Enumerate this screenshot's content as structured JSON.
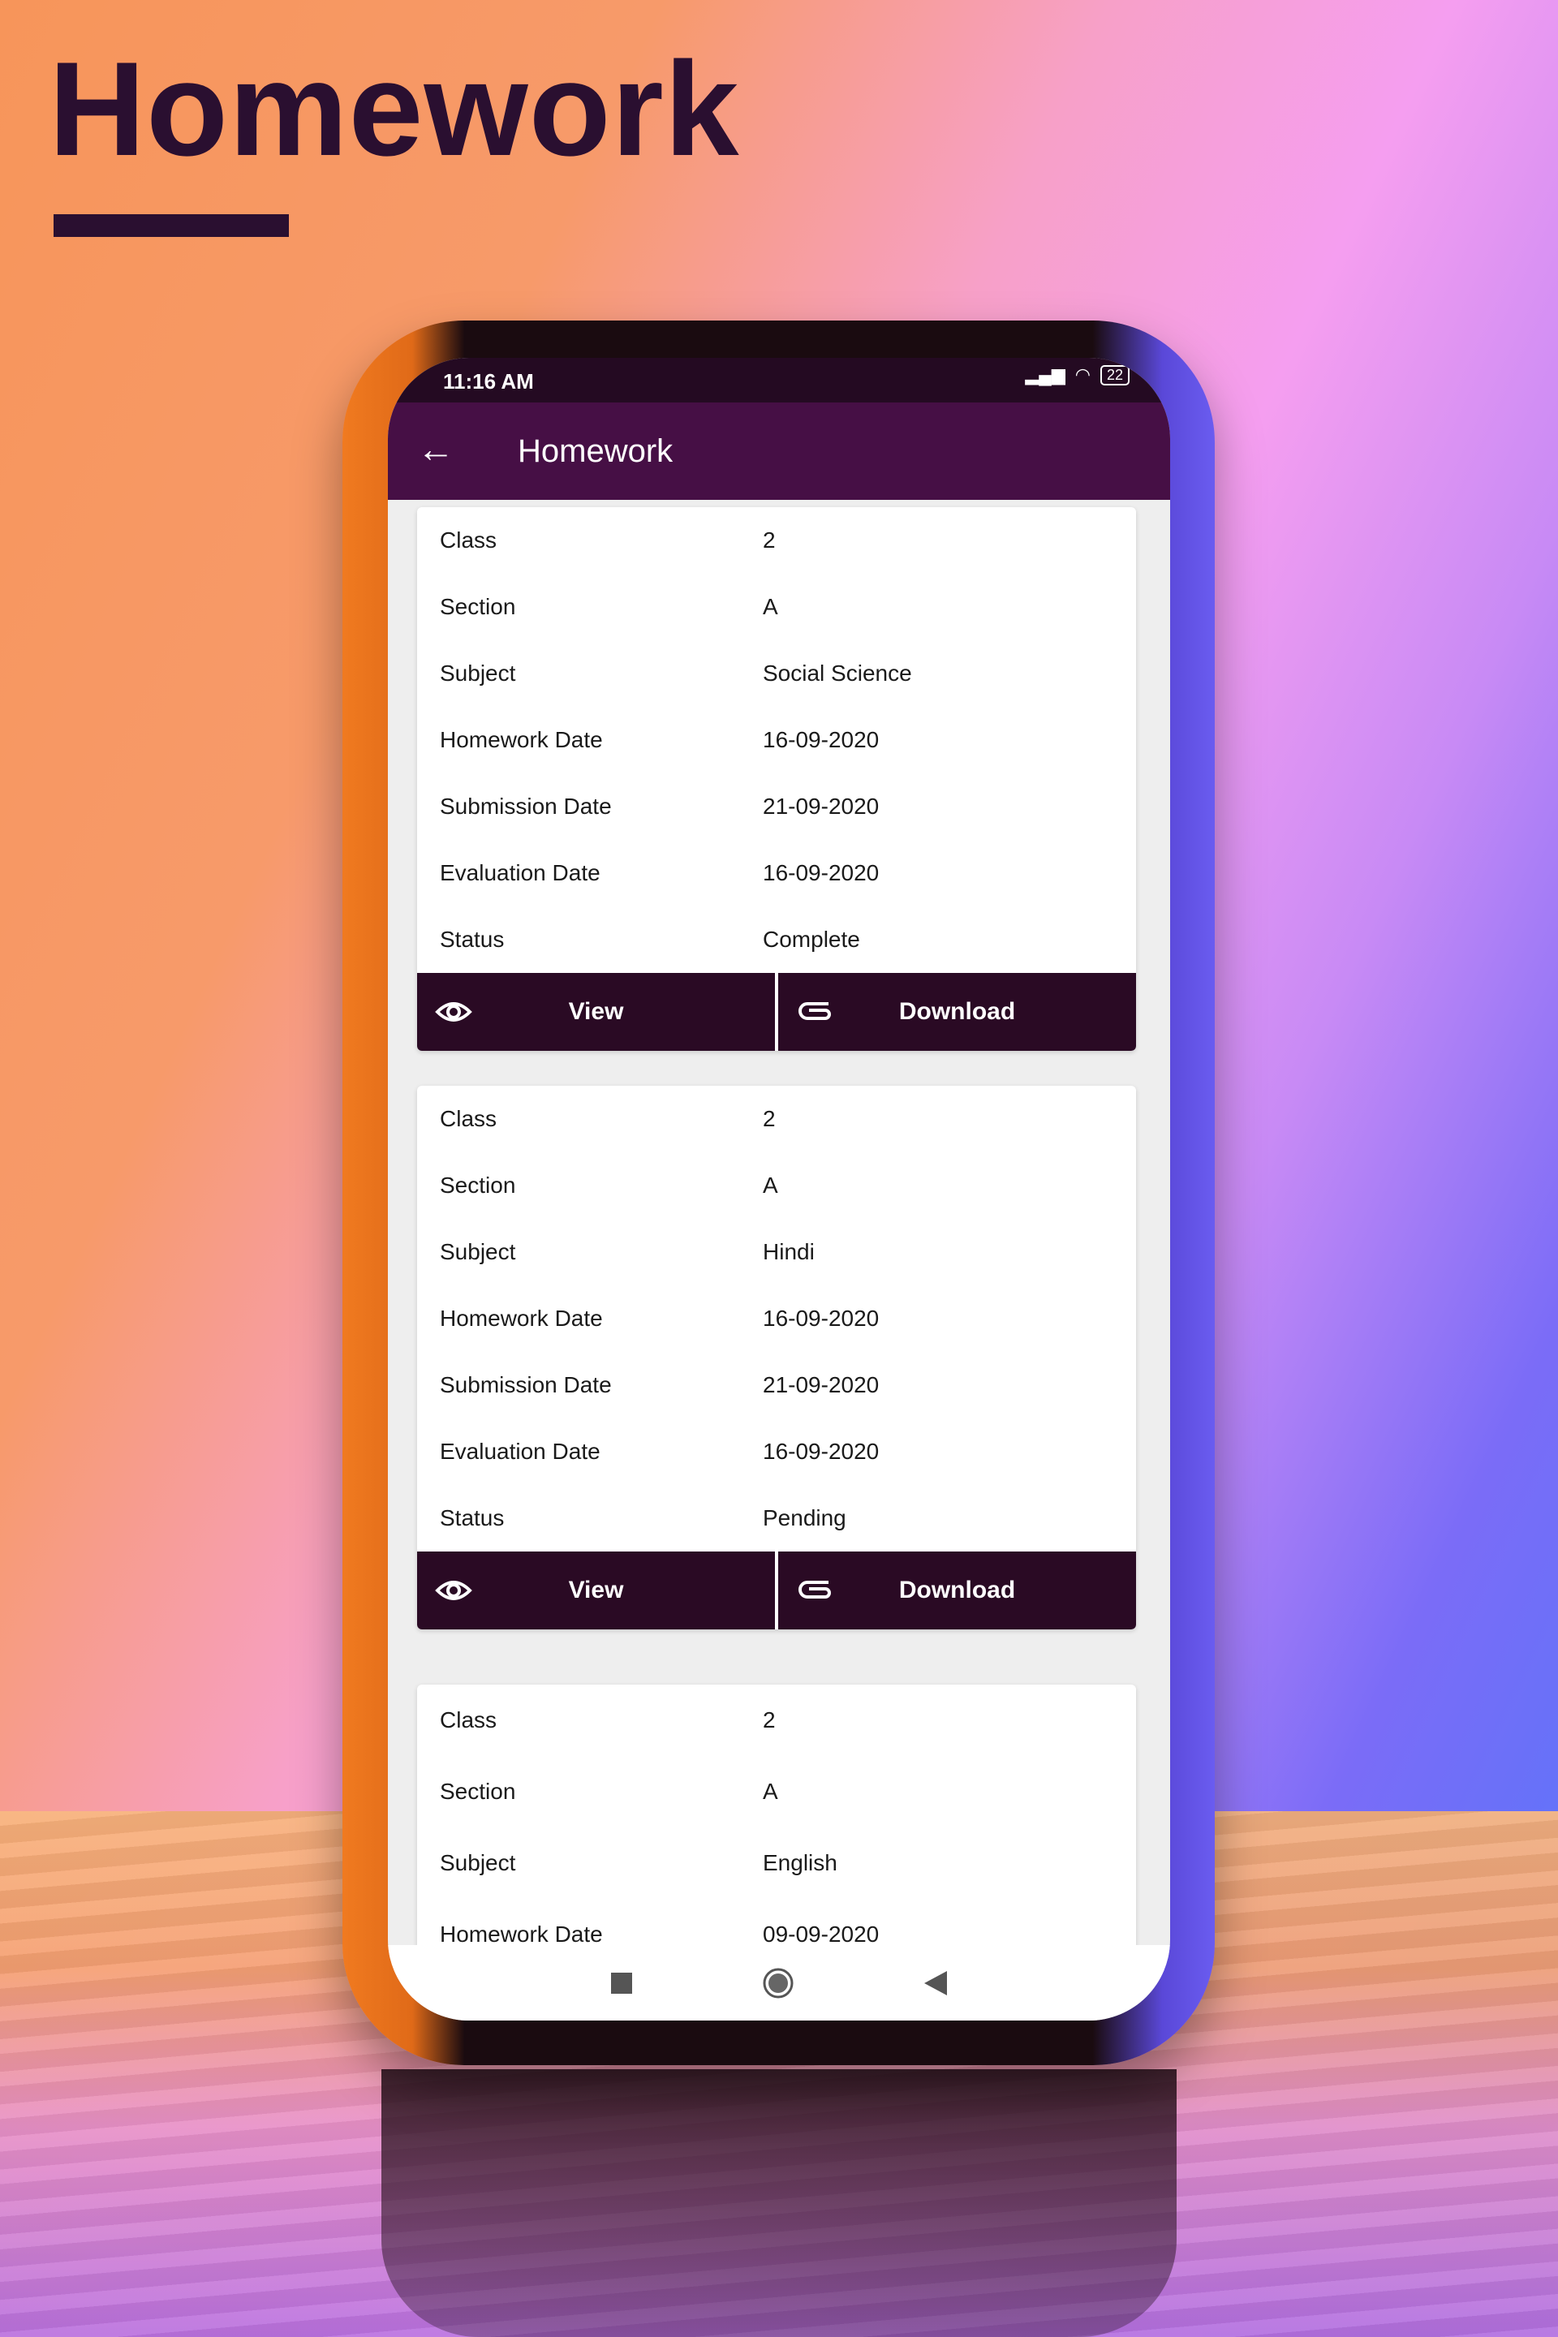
{
  "promo": {
    "title": "Homework"
  },
  "status_bar": {
    "time": "11:16 AM",
    "battery": "22"
  },
  "app_bar": {
    "title": "Homework"
  },
  "labels": {
    "class": "Class",
    "section": "Section",
    "subject": "Subject",
    "homework_date": "Homework Date",
    "submission_date": "Submission Date",
    "evaluation_date": "Evaluation Date",
    "status": "Status"
  },
  "buttons": {
    "view": "View",
    "download": "Download"
  },
  "cards": [
    {
      "class": "2",
      "section": "A",
      "subject": "Social Science",
      "homework_date": "16-09-2020",
      "submission_date": "21-09-2020",
      "evaluation_date": "16-09-2020",
      "status": "Complete"
    },
    {
      "class": "2",
      "section": "A",
      "subject": "Hindi",
      "homework_date": "16-09-2020",
      "submission_date": "21-09-2020",
      "evaluation_date": "16-09-2020",
      "status": "Pending"
    },
    {
      "class": "2",
      "section": "A",
      "subject": "English",
      "homework_date": "09-09-2020"
    }
  ],
  "colors": {
    "app_bar": "#460f45",
    "status_bar": "#240a22",
    "button": "#2a0a24",
    "title": "#2a0f30"
  },
  "icons": {
    "back": "arrow-left-icon",
    "view": "eye-icon",
    "download": "paperclip-icon",
    "nav": [
      "square-icon",
      "circle-icon",
      "triangle-back-icon"
    ]
  }
}
